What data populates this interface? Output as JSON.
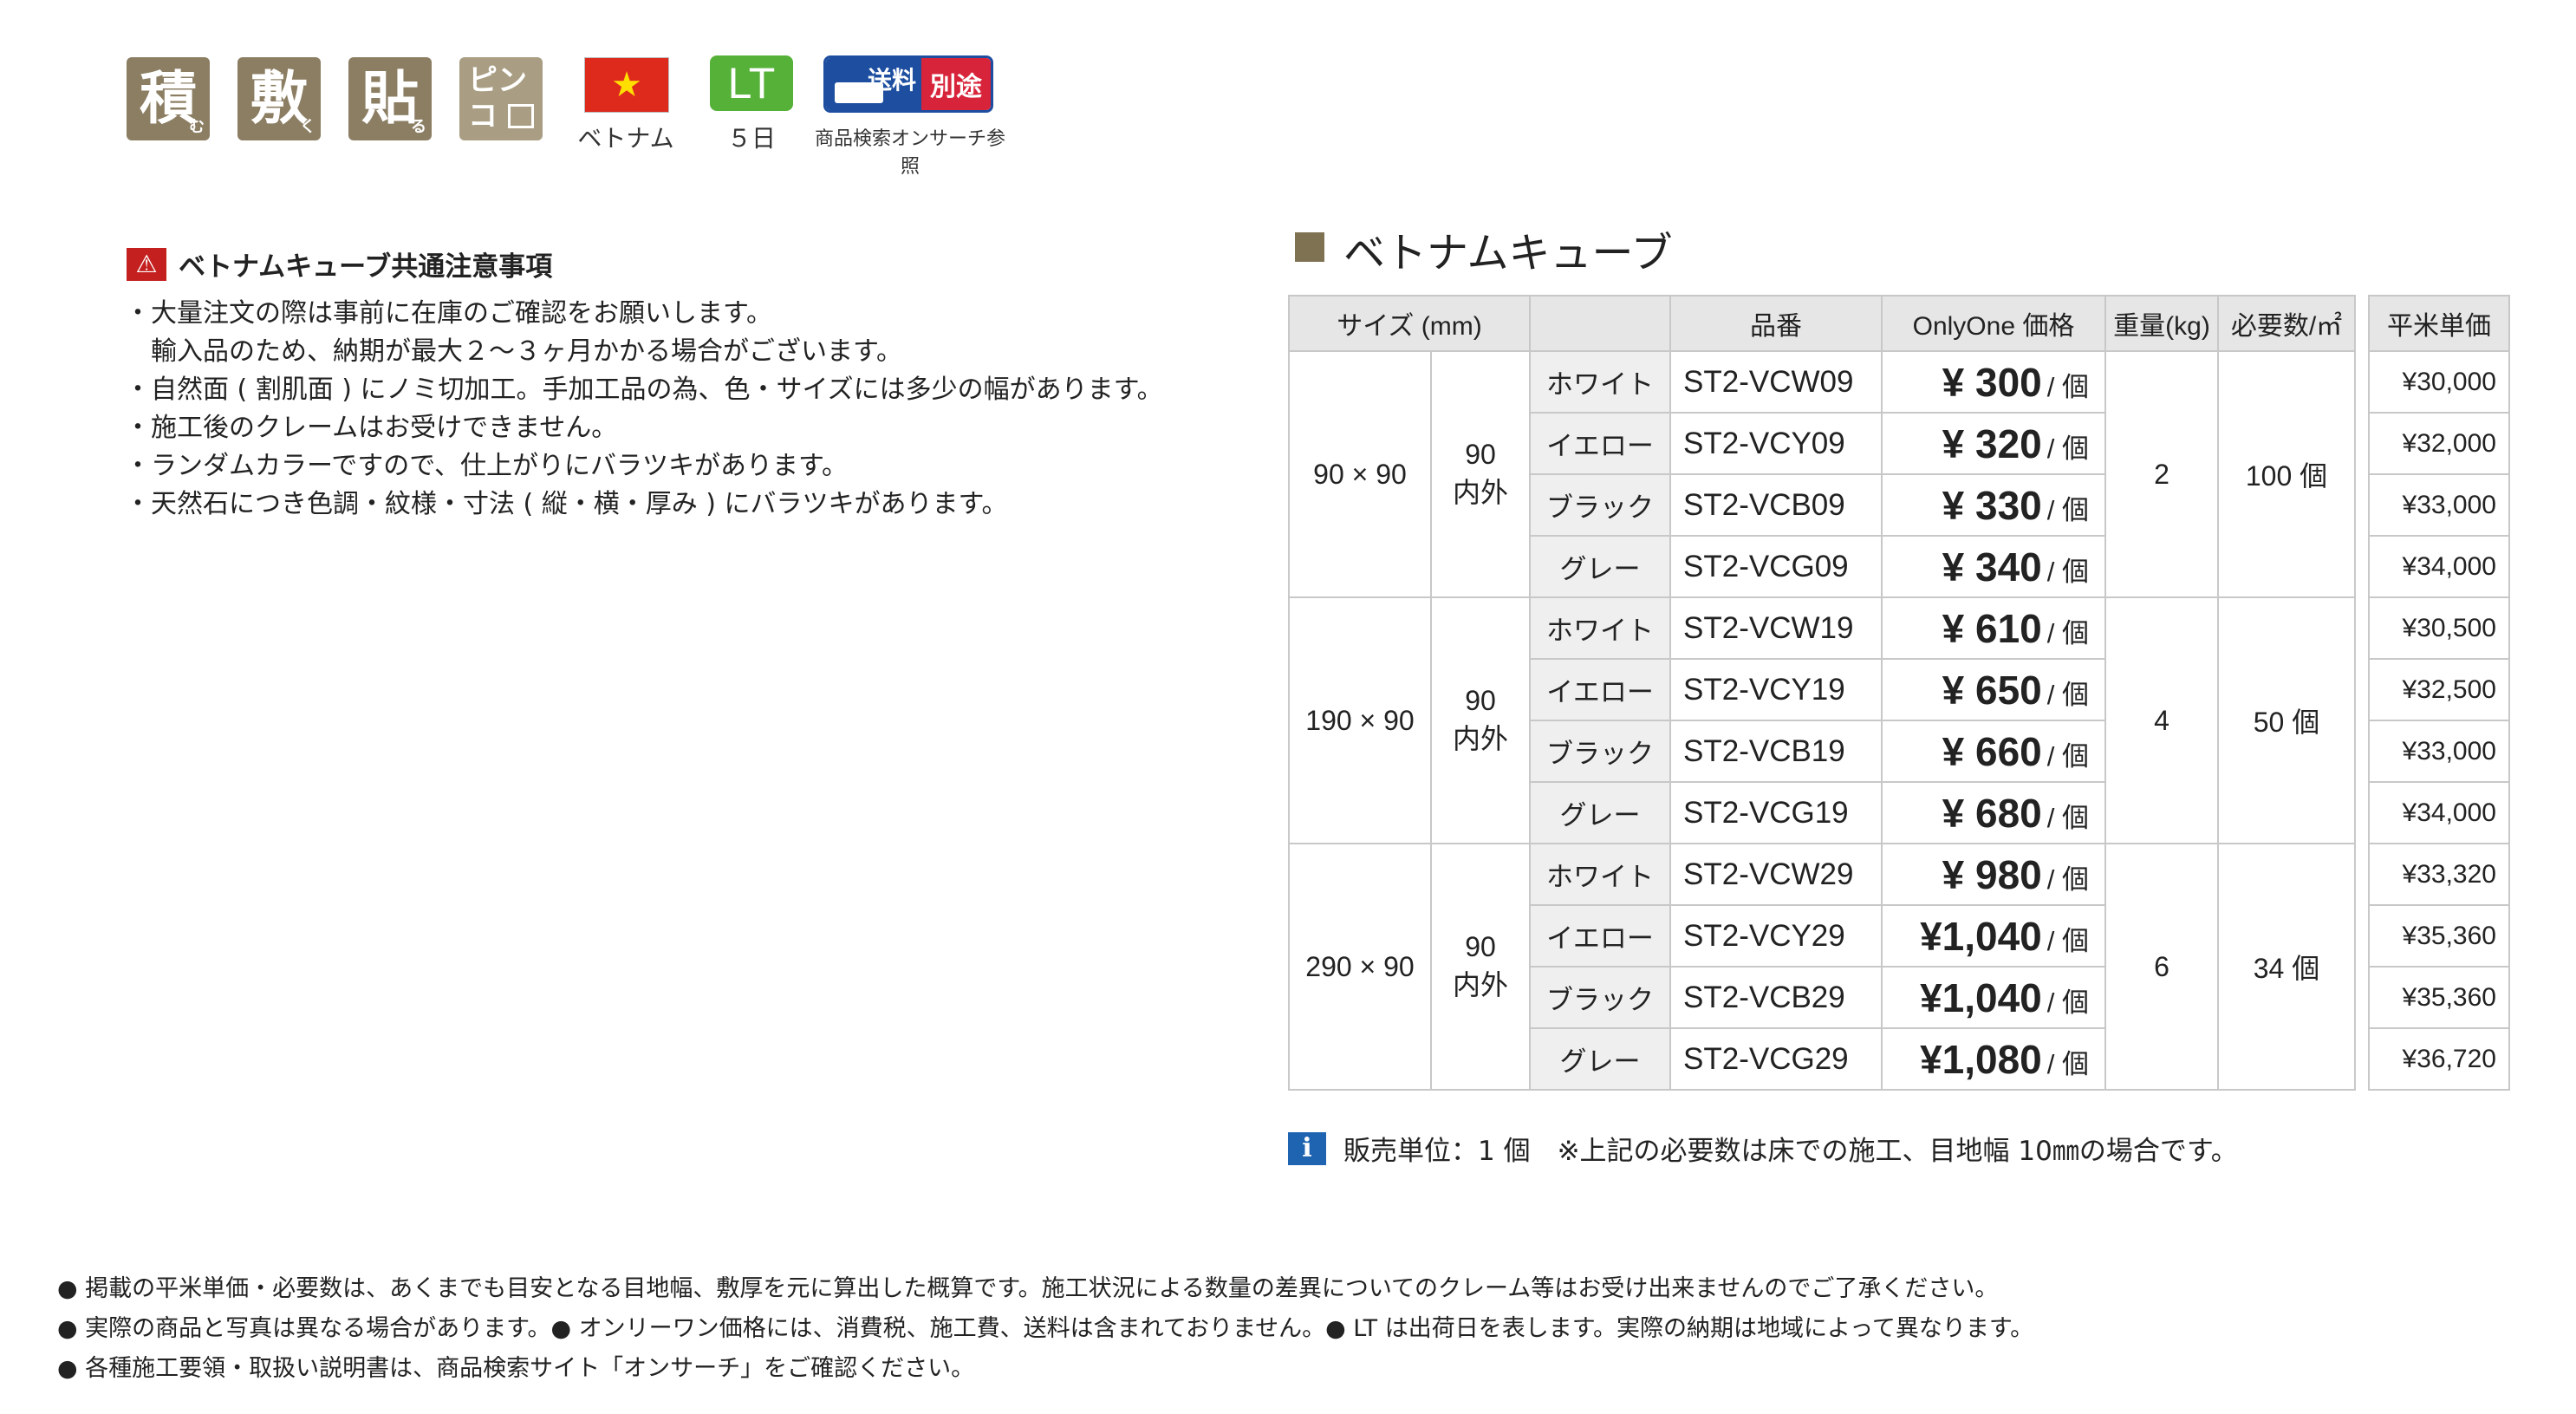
{
  "badges": {
    "icons": [
      {
        "char": "積",
        "sub": "む"
      },
      {
        "char": "敷",
        "sub": "く"
      },
      {
        "char": "貼",
        "sub": "る"
      },
      {
        "char": "ピン\nコ",
        "sub": ""
      }
    ],
    "country_label": "ベトナム",
    "lt_label": "LT",
    "lt_caption": "５日",
    "shipping_left": "送料",
    "shipping_right": "別途",
    "shipping_caption": "商品検索オンサーチ参照",
    "flag_colors": {
      "field": "#dd2a1d",
      "star": "#ffde00"
    }
  },
  "notice": {
    "title": "ベトナムキューブ共通注意事項",
    "lines": [
      "・大量注文の際は事前に在庫のご確認をお願いします。",
      "　輸入品のため、納期が最大２〜３ヶ月かかる場合がございます。",
      "・自然面 ( 割肌面 ) にノミ切加工。手加工品の為、色・サイズには多少の幅があります。",
      "・施工後のクレームはお受けできません。",
      "・ランダムカラーですので、仕上がりにバラツキがあります。",
      "・天然石につき色調・紋様・寸法 ( 縦・横・厚み ) にバラツキがあります。"
    ]
  },
  "section_title": "ベトナムキューブ",
  "table": {
    "headers": {
      "size": "サイズ (mm)",
      "code": "品番",
      "price": "OnlyOne 価格",
      "weight": "重量(kg)",
      "required": "必要数/㎡",
      "unit_price": "平米単価"
    },
    "price_unit": "/ 個",
    "groups": [
      {
        "size": "90 × 90",
        "thick_1": "90",
        "thick_2": "内外",
        "weight": "2",
        "required": "100 個",
        "rows": [
          {
            "color": "ホワイト",
            "code": "ST2-VCW09",
            "price": "¥ 300",
            "unit_price": "¥30,000"
          },
          {
            "color": "イエロー",
            "code": "ST2-VCY09",
            "price": "¥ 320",
            "unit_price": "¥32,000"
          },
          {
            "color": "ブラック",
            "code": "ST2-VCB09",
            "price": "¥ 330",
            "unit_price": "¥33,000"
          },
          {
            "color": "グレー",
            "code": "ST2-VCG09",
            "price": "¥ 340",
            "unit_price": "¥34,000"
          }
        ]
      },
      {
        "size": "190 × 90",
        "thick_1": "90",
        "thick_2": "内外",
        "weight": "4",
        "required": "50 個",
        "rows": [
          {
            "color": "ホワイト",
            "code": "ST2-VCW19",
            "price": "¥ 610",
            "unit_price": "¥30,500"
          },
          {
            "color": "イエロー",
            "code": "ST2-VCY19",
            "price": "¥ 650",
            "unit_price": "¥32,500"
          },
          {
            "color": "ブラック",
            "code": "ST2-VCB19",
            "price": "¥ 660",
            "unit_price": "¥33,000"
          },
          {
            "color": "グレー",
            "code": "ST2-VCG19",
            "price": "¥ 680",
            "unit_price": "¥34,000"
          }
        ]
      },
      {
        "size": "290 × 90",
        "thick_1": "90",
        "thick_2": "内外",
        "weight": "6",
        "required": "34 個",
        "rows": [
          {
            "color": "ホワイト",
            "code": "ST2-VCW29",
            "price": "¥ 980",
            "unit_price": "¥33,320"
          },
          {
            "color": "イエロー",
            "code": "ST2-VCY29",
            "price": "¥1,040",
            "unit_price": "¥35,360"
          },
          {
            "color": "ブラック",
            "code": "ST2-VCB29",
            "price": "¥1,040",
            "unit_price": "¥35,360"
          },
          {
            "color": "グレー",
            "code": "ST2-VCG29",
            "price": "¥1,080",
            "unit_price": "¥36,720"
          }
        ]
      }
    ]
  },
  "info_note": "販売単位：1 個　※上記の必要数は床での施工、目地幅 10㎜の場合です。",
  "footer": [
    "● 掲載の平米単価・必要数は、あくまでも目安となる目地幅、敷厚を元に算出した概算です。施工状況による数量の差異についてのクレーム等はお受け出来ませんのでご了承ください。",
    "● 実際の商品と写真は異なる場合があります。● オンリーワン価格には、消費税、施工費、送料は含まれておりません。● LT は出荷日を表します。実際の納期は地域によって異なります。",
    "● 各種施工要領・取扱い説明書は、商品検索サイト「オンサーチ」をご確認ください。"
  ]
}
